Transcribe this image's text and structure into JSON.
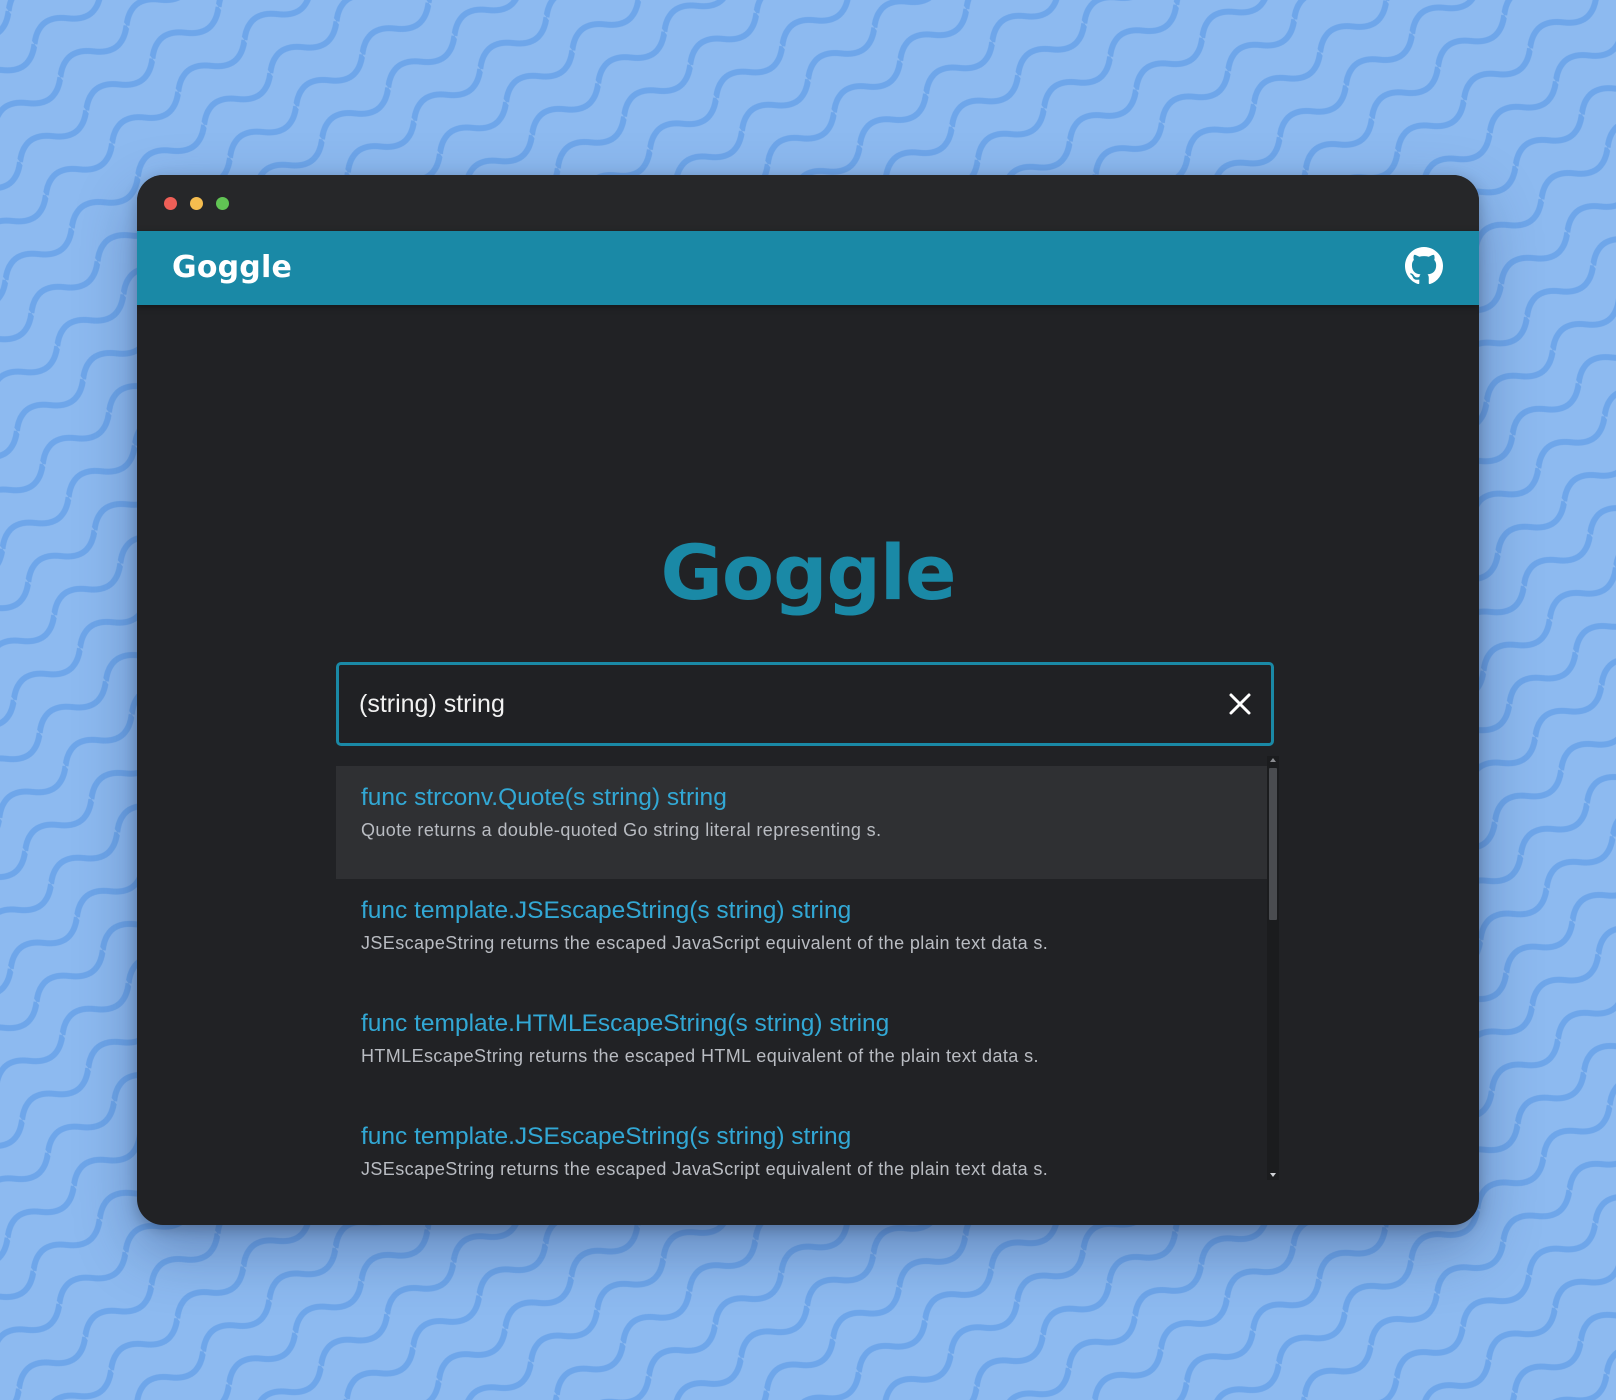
{
  "app": {
    "title": "Goggle",
    "logo_text": "Goggle",
    "accent_color": "#1a89a6",
    "link_color": "#32a8d5",
    "github_icon": "github-icon"
  },
  "search": {
    "value": "(string) string",
    "clear_icon": "close-icon"
  },
  "results": [
    {
      "signature": "func strconv.Quote(s string) string",
      "description": "Quote returns a double-quoted Go string literal representing s."
    },
    {
      "signature": "func template.JSEscapeString(s string) string",
      "description": "JSEscapeString returns the escaped JavaScript equivalent of the plain text data s."
    },
    {
      "signature": "func template.HTMLEscapeString(s string) string",
      "description": "HTMLEscapeString returns the escaped HTML equivalent of the plain text data s."
    },
    {
      "signature": "func template.JSEscapeString(s string) string",
      "description": "JSEscapeString returns the escaped JavaScript equivalent of the plain text data s."
    }
  ]
}
